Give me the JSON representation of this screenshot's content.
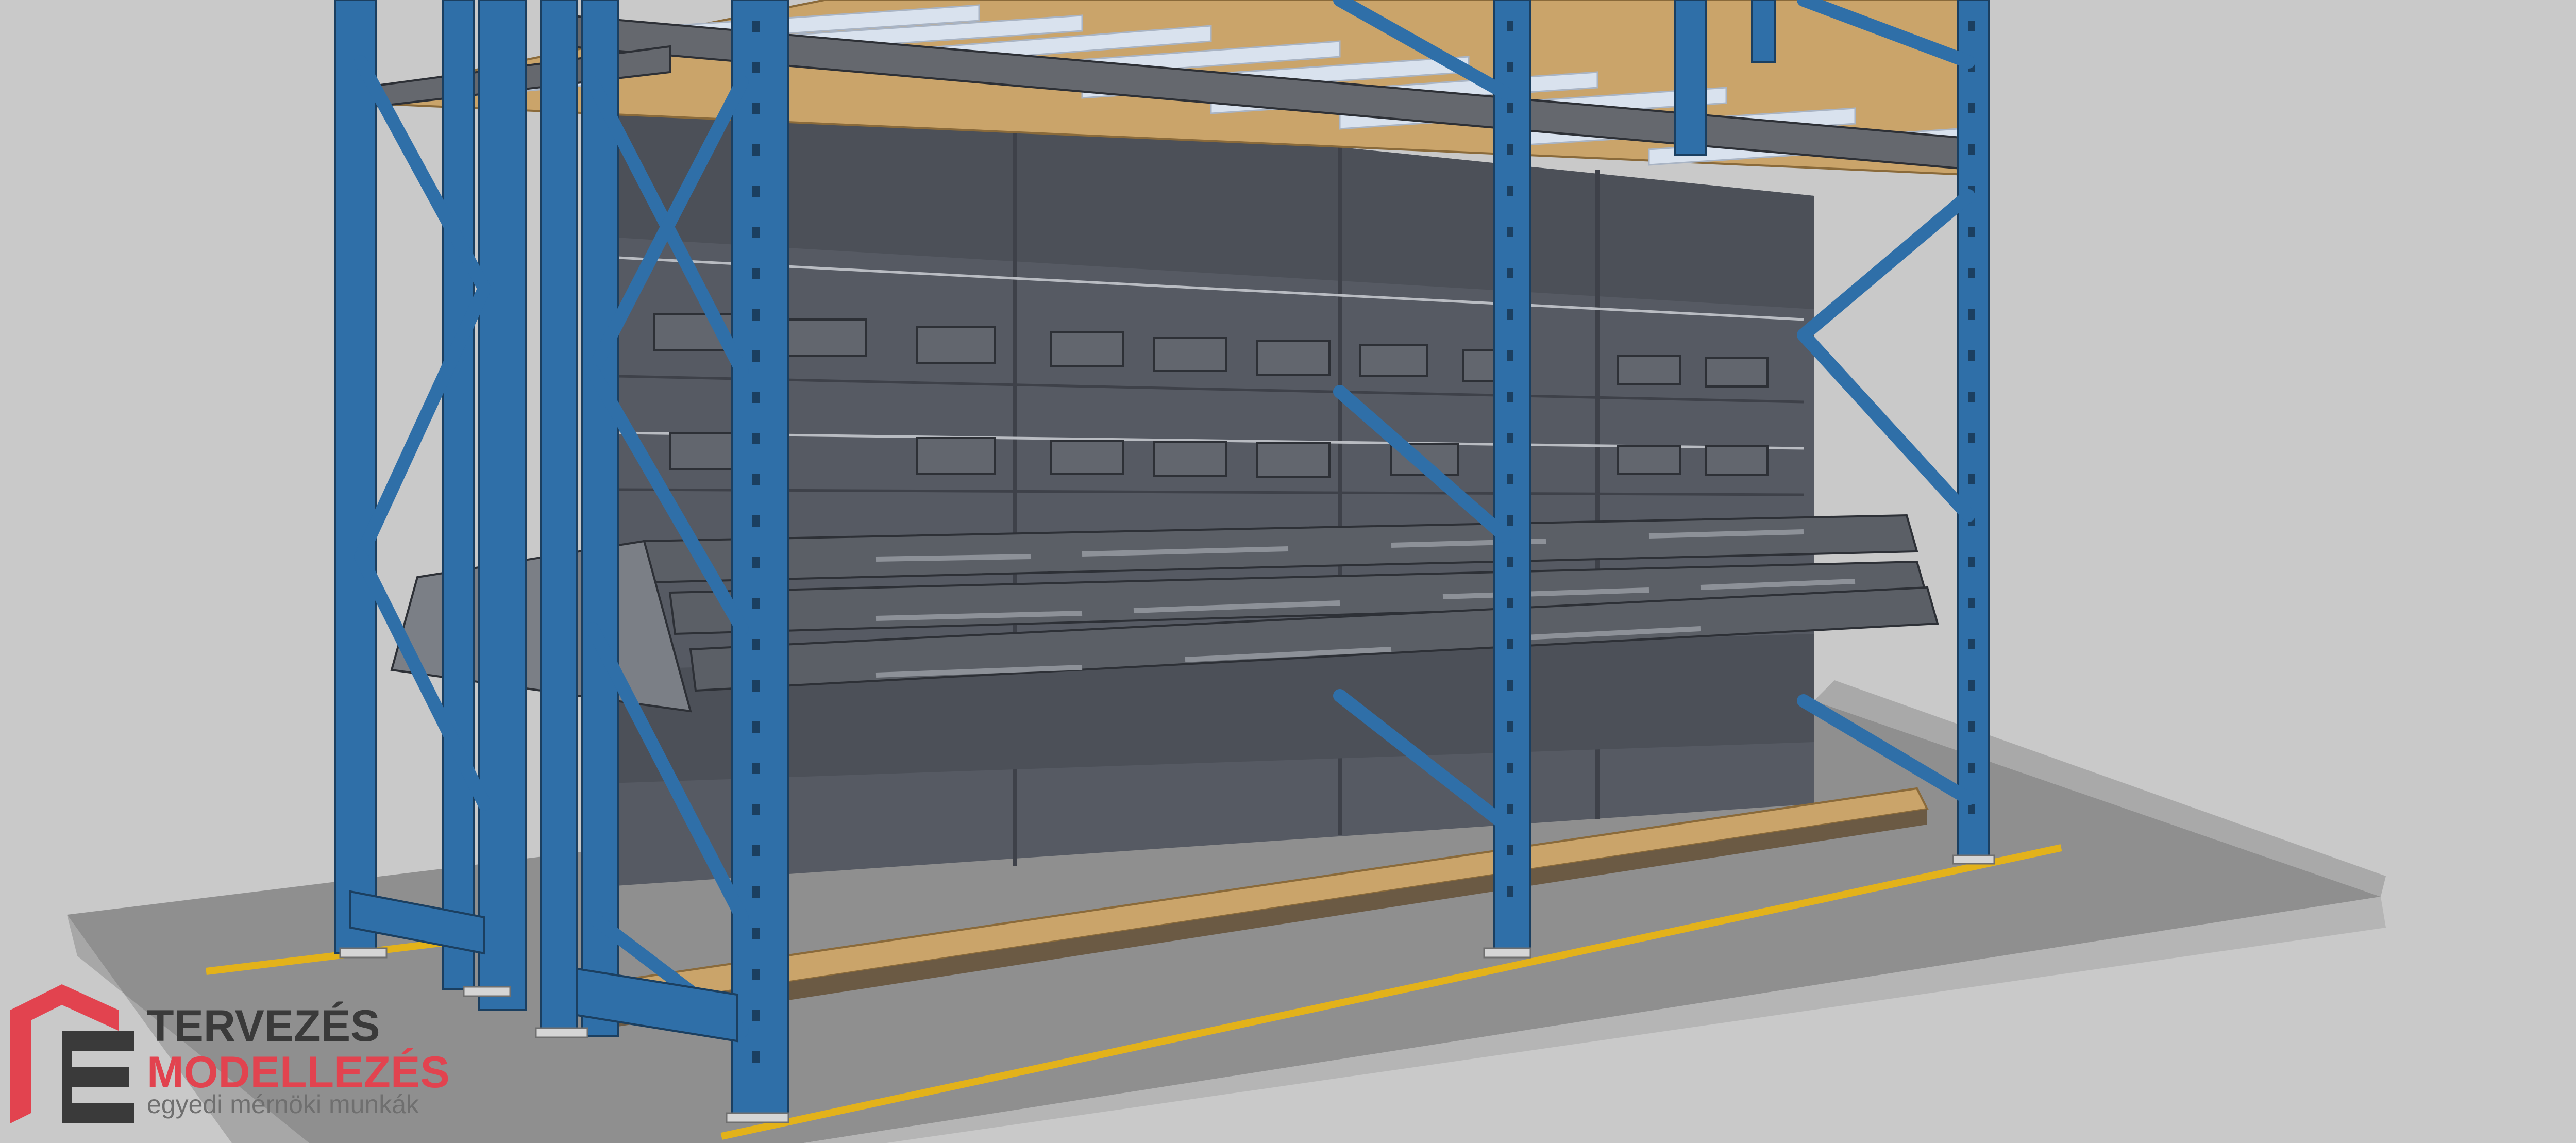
{
  "colors": {
    "background": "#c9c9c9",
    "floor_top": "#8f8f8f",
    "floor_edge": "#b5b5b5",
    "floor_front": "#a7a7a7",
    "safety_line": "#e3b21a",
    "upright_blue": "#2f6fa8",
    "upright_dark": "#23577f",
    "panel_gray": "#565a63",
    "panel_dark": "#3e4149",
    "shelf_bin": "#5b5f66",
    "wood": "#caa46a",
    "beam_gray": "#65686e",
    "slat_light": "#d9e2ee",
    "logo_red": "#e2434f",
    "logo_dark": "#3a3a3a",
    "logo_gray": "#6f6f6f"
  },
  "logo": {
    "line1": "TERVEZÉS",
    "line2": "MODELLEZÉS",
    "line3": "egyedi mérnöki munkák"
  }
}
